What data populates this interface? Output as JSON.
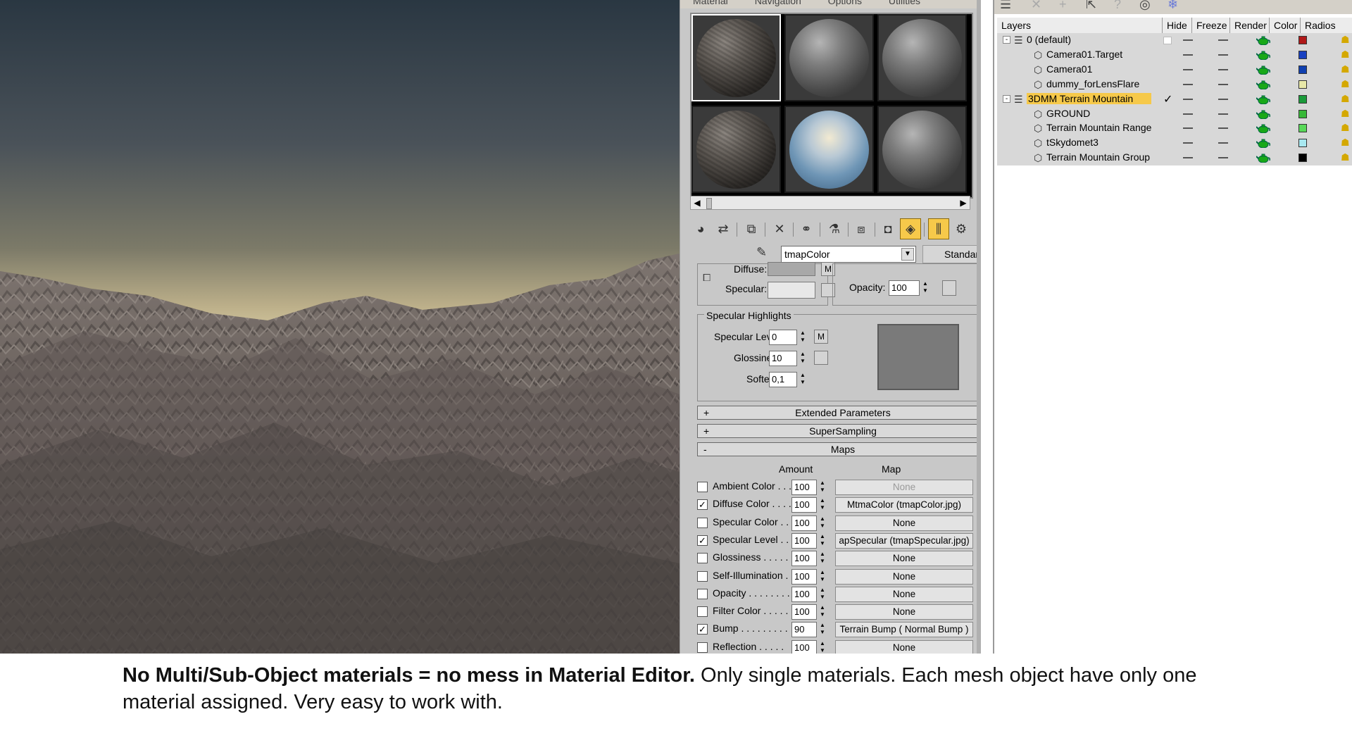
{
  "material_editor": {
    "menu": [
      "Material",
      "Navigation",
      "Options",
      "Utilities"
    ],
    "material_name": "tmapColor",
    "material_type": "Standard",
    "basic": {
      "diffuse_label": "Diffuse:",
      "diffuse_map_button": "M",
      "specular_label": "Specular:",
      "opacity_label": "Opacity:",
      "opacity_value": "100"
    },
    "specular_highlights": {
      "title": "Specular Highlights",
      "specular_level_label": "Specular Level:",
      "specular_level_value": "0",
      "specular_level_map_button": "M",
      "glossiness_label": "Glossiness:",
      "glossiness_value": "10",
      "soften_label": "Soften:",
      "soften_value": "0,1"
    },
    "rollouts": [
      {
        "sign": "+",
        "label": "Extended Parameters"
      },
      {
        "sign": "+",
        "label": "SuperSampling"
      },
      {
        "sign": "-",
        "label": "Maps"
      }
    ],
    "maps": {
      "amount_header": "Amount",
      "map_header": "Map",
      "rows": [
        {
          "label": "Ambient Color . . .",
          "checked": false,
          "amount": "100",
          "map": "None"
        },
        {
          "label": "Diffuse Color . . . .",
          "checked": true,
          "amount": "100",
          "map": "MtmaColor (tmapColor.jpg)"
        },
        {
          "label": "Specular Color . .",
          "checked": false,
          "amount": "100",
          "map": "None"
        },
        {
          "label": "Specular Level . .",
          "checked": true,
          "amount": "100",
          "map": "apSpecular (tmapSpecular.jpg)"
        },
        {
          "label": "Glossiness . . . . .",
          "checked": false,
          "amount": "100",
          "map": "None"
        },
        {
          "label": "Self-Illumination .",
          "checked": false,
          "amount": "100",
          "map": "None"
        },
        {
          "label": "Opacity . . . . . . . .",
          "checked": false,
          "amount": "100",
          "map": "None"
        },
        {
          "label": "Filter Color . . . . .",
          "checked": false,
          "amount": "100",
          "map": "None"
        },
        {
          "label": "Bump . . . . . . . . .",
          "checked": true,
          "amount": "90",
          "map": "Terrain Bump  ( Normal Bump )"
        },
        {
          "label": "Reflection . . . . .",
          "checked": false,
          "amount": "100",
          "map": "None"
        }
      ]
    }
  },
  "layers": {
    "columns": [
      "Layers",
      "Hide",
      "Freeze",
      "Render",
      "Color",
      "Radios"
    ],
    "rows": [
      {
        "name": "0 (default)",
        "type": "layer",
        "expander": "-",
        "color": "#b01818",
        "current": false,
        "selected": false
      },
      {
        "name": "Camera01.Target",
        "type": "object",
        "color": "#1840c0"
      },
      {
        "name": "Camera01",
        "type": "object",
        "color": "#1040b0"
      },
      {
        "name": "dummy_forLensFlare",
        "type": "object",
        "color": "#e8e8a8"
      },
      {
        "name": "3DMM Terrain Mountain",
        "type": "layer",
        "expander": "-",
        "color": "#1a9a3a",
        "current": true,
        "selected": true
      },
      {
        "name": "GROUND",
        "type": "object",
        "color": "#38b838"
      },
      {
        "name": "Terrain Mountain Range",
        "type": "object",
        "color": "#58d858"
      },
      {
        "name": "tSkydomet3",
        "type": "object",
        "color": "#a8e8f0"
      },
      {
        "name": "Terrain Mountain Group",
        "type": "object",
        "color": "#000000"
      }
    ]
  },
  "caption": {
    "bold": "No Multi/Sub-Object materials = no mess in Material Editor.",
    "rest": " Only single materials. Each mesh object have only one material assigned. Very easy to work with."
  }
}
